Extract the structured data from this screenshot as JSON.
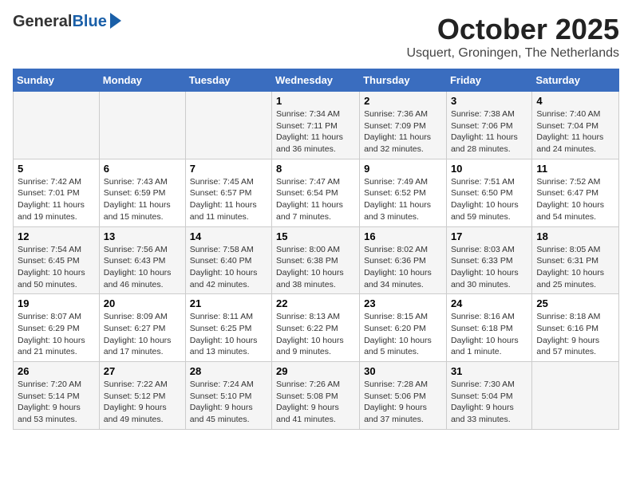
{
  "header": {
    "logo_general": "General",
    "logo_blue": "Blue",
    "month": "October 2025",
    "location": "Usquert, Groningen, The Netherlands"
  },
  "weekdays": [
    "Sunday",
    "Monday",
    "Tuesday",
    "Wednesday",
    "Thursday",
    "Friday",
    "Saturday"
  ],
  "weeks": [
    [
      {
        "day": "",
        "info": ""
      },
      {
        "day": "",
        "info": ""
      },
      {
        "day": "",
        "info": ""
      },
      {
        "day": "1",
        "info": "Sunrise: 7:34 AM\nSunset: 7:11 PM\nDaylight: 11 hours\nand 36 minutes."
      },
      {
        "day": "2",
        "info": "Sunrise: 7:36 AM\nSunset: 7:09 PM\nDaylight: 11 hours\nand 32 minutes."
      },
      {
        "day": "3",
        "info": "Sunrise: 7:38 AM\nSunset: 7:06 PM\nDaylight: 11 hours\nand 28 minutes."
      },
      {
        "day": "4",
        "info": "Sunrise: 7:40 AM\nSunset: 7:04 PM\nDaylight: 11 hours\nand 24 minutes."
      }
    ],
    [
      {
        "day": "5",
        "info": "Sunrise: 7:42 AM\nSunset: 7:01 PM\nDaylight: 11 hours\nand 19 minutes."
      },
      {
        "day": "6",
        "info": "Sunrise: 7:43 AM\nSunset: 6:59 PM\nDaylight: 11 hours\nand 15 minutes."
      },
      {
        "day": "7",
        "info": "Sunrise: 7:45 AM\nSunset: 6:57 PM\nDaylight: 11 hours\nand 11 minutes."
      },
      {
        "day": "8",
        "info": "Sunrise: 7:47 AM\nSunset: 6:54 PM\nDaylight: 11 hours\nand 7 minutes."
      },
      {
        "day": "9",
        "info": "Sunrise: 7:49 AM\nSunset: 6:52 PM\nDaylight: 11 hours\nand 3 minutes."
      },
      {
        "day": "10",
        "info": "Sunrise: 7:51 AM\nSunset: 6:50 PM\nDaylight: 10 hours\nand 59 minutes."
      },
      {
        "day": "11",
        "info": "Sunrise: 7:52 AM\nSunset: 6:47 PM\nDaylight: 10 hours\nand 54 minutes."
      }
    ],
    [
      {
        "day": "12",
        "info": "Sunrise: 7:54 AM\nSunset: 6:45 PM\nDaylight: 10 hours\nand 50 minutes."
      },
      {
        "day": "13",
        "info": "Sunrise: 7:56 AM\nSunset: 6:43 PM\nDaylight: 10 hours\nand 46 minutes."
      },
      {
        "day": "14",
        "info": "Sunrise: 7:58 AM\nSunset: 6:40 PM\nDaylight: 10 hours\nand 42 minutes."
      },
      {
        "day": "15",
        "info": "Sunrise: 8:00 AM\nSunset: 6:38 PM\nDaylight: 10 hours\nand 38 minutes."
      },
      {
        "day": "16",
        "info": "Sunrise: 8:02 AM\nSunset: 6:36 PM\nDaylight: 10 hours\nand 34 minutes."
      },
      {
        "day": "17",
        "info": "Sunrise: 8:03 AM\nSunset: 6:33 PM\nDaylight: 10 hours\nand 30 minutes."
      },
      {
        "day": "18",
        "info": "Sunrise: 8:05 AM\nSunset: 6:31 PM\nDaylight: 10 hours\nand 25 minutes."
      }
    ],
    [
      {
        "day": "19",
        "info": "Sunrise: 8:07 AM\nSunset: 6:29 PM\nDaylight: 10 hours\nand 21 minutes."
      },
      {
        "day": "20",
        "info": "Sunrise: 8:09 AM\nSunset: 6:27 PM\nDaylight: 10 hours\nand 17 minutes."
      },
      {
        "day": "21",
        "info": "Sunrise: 8:11 AM\nSunset: 6:25 PM\nDaylight: 10 hours\nand 13 minutes."
      },
      {
        "day": "22",
        "info": "Sunrise: 8:13 AM\nSunset: 6:22 PM\nDaylight: 10 hours\nand 9 minutes."
      },
      {
        "day": "23",
        "info": "Sunrise: 8:15 AM\nSunset: 6:20 PM\nDaylight: 10 hours\nand 5 minutes."
      },
      {
        "day": "24",
        "info": "Sunrise: 8:16 AM\nSunset: 6:18 PM\nDaylight: 10 hours\nand 1 minute."
      },
      {
        "day": "25",
        "info": "Sunrise: 8:18 AM\nSunset: 6:16 PM\nDaylight: 9 hours\nand 57 minutes."
      }
    ],
    [
      {
        "day": "26",
        "info": "Sunrise: 7:20 AM\nSunset: 5:14 PM\nDaylight: 9 hours\nand 53 minutes."
      },
      {
        "day": "27",
        "info": "Sunrise: 7:22 AM\nSunset: 5:12 PM\nDaylight: 9 hours\nand 49 minutes."
      },
      {
        "day": "28",
        "info": "Sunrise: 7:24 AM\nSunset: 5:10 PM\nDaylight: 9 hours\nand 45 minutes."
      },
      {
        "day": "29",
        "info": "Sunrise: 7:26 AM\nSunset: 5:08 PM\nDaylight: 9 hours\nand 41 minutes."
      },
      {
        "day": "30",
        "info": "Sunrise: 7:28 AM\nSunset: 5:06 PM\nDaylight: 9 hours\nand 37 minutes."
      },
      {
        "day": "31",
        "info": "Sunrise: 7:30 AM\nSunset: 5:04 PM\nDaylight: 9 hours\nand 33 minutes."
      },
      {
        "day": "",
        "info": ""
      }
    ]
  ]
}
